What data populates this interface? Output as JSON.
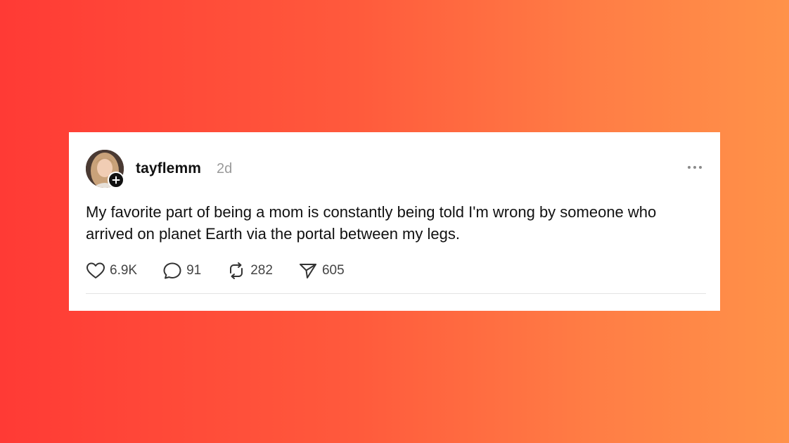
{
  "post": {
    "username": "tayflemm",
    "time_ago": "2d",
    "text": "My favorite part of being a mom is constantly being told I'm wrong by someone who arrived on planet Earth via the portal between my legs.",
    "actions": {
      "likes": "6.9K",
      "replies": "91",
      "reposts": "282",
      "shares": "605"
    }
  },
  "icons": {
    "follow": "plus-icon",
    "more": "more-dots-icon",
    "like": "heart-icon",
    "reply": "comment-bubble-icon",
    "repost": "repost-arrows-icon",
    "share": "send-paper-plane-icon"
  },
  "colors": {
    "background_start": "#ff3a35",
    "background_end": "#ff9249",
    "card": "#ffffff",
    "text": "#111111",
    "muted": "#9a9a9a"
  }
}
